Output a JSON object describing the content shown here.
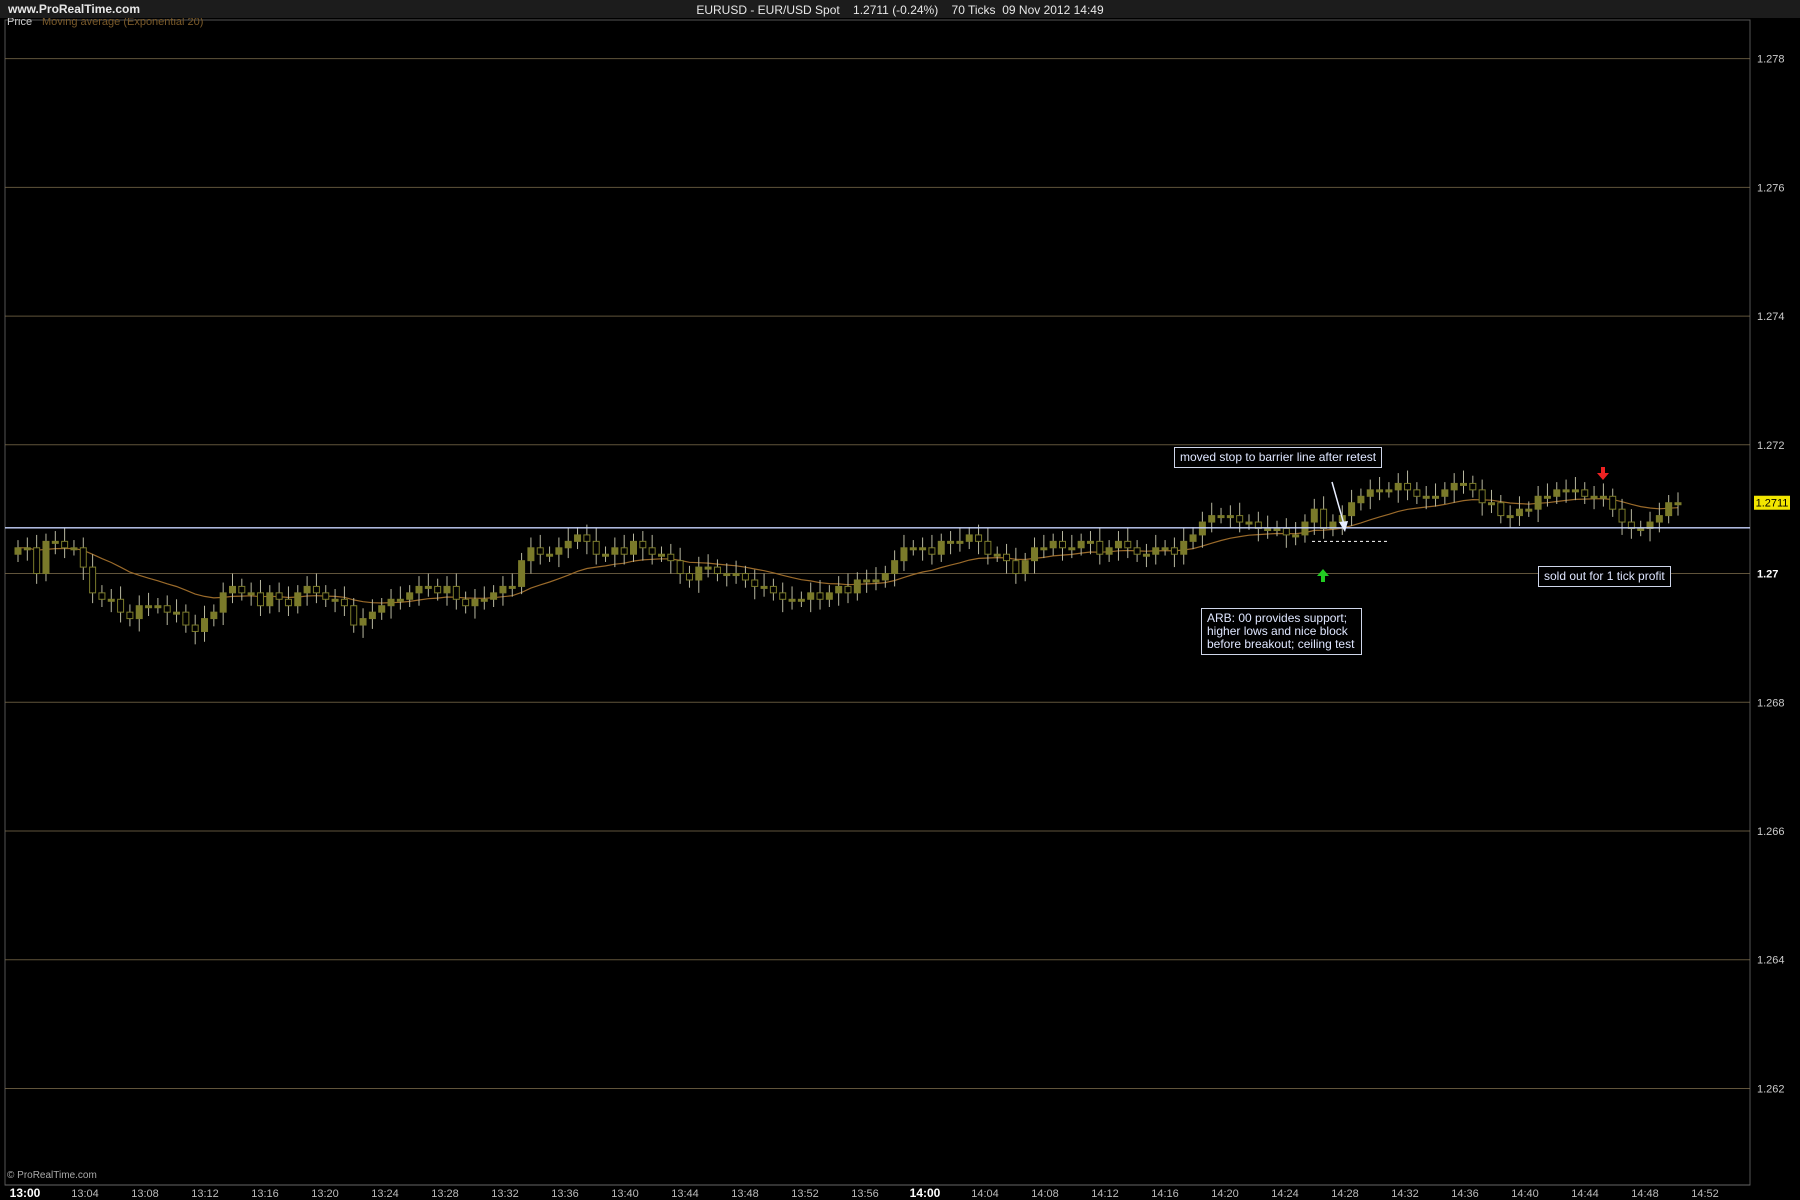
{
  "header": {
    "site": "www.ProRealTime.com",
    "info": "EURUSD - EUR/USD Spot    1.2711 (-0.24%)    70 Ticks  09 Nov 2012 14:49"
  },
  "legend": {
    "price": "Price",
    "indicator": "Moving average (Exponential 20)"
  },
  "footer": {
    "copyright": "© ProRealTime.com"
  },
  "colors": {
    "background": "#000000",
    "grid": "#7a6a4a",
    "candle": "#7a7a2a",
    "wick": "#b7b7a0",
    "ma": "#9a6a2a",
    "barrier": "#c8d4ff",
    "price_tag_bg": "#f2e600",
    "up_arrow": "#22cc22",
    "down_arrow": "#ee2222"
  },
  "chart_data": {
    "type": "candlestick",
    "y_range": [
      1.2605,
      1.2786
    ],
    "y_ticks": [
      "1.278",
      "1.276",
      "1.274",
      "1.272",
      "1.27",
      "1.268",
      "1.266",
      "1.264",
      "1.262"
    ],
    "x_ticks": [
      "13:00",
      "13:04",
      "13:08",
      "13:12",
      "13:16",
      "13:20",
      "13:24",
      "13:28",
      "13:32",
      "13:36",
      "13:40",
      "13:44",
      "13:48",
      "13:52",
      "13:56",
      "14:00",
      "14:04",
      "14:08",
      "14:12",
      "14:16",
      "14:20",
      "14:24",
      "14:28",
      "14:32",
      "14:36",
      "14:40",
      "14:44",
      "14:48",
      "14:52"
    ],
    "last_price": "1.2711",
    "barrier_level": 1.27071,
    "stop_level": 1.2705,
    "series_close": [
      1.2704,
      1.2704,
      1.27,
      1.2705,
      1.2705,
      1.2704,
      1.2704,
      1.2701,
      1.2697,
      1.2696,
      1.2696,
      1.2694,
      1.2693,
      1.2695,
      1.2695,
      1.2695,
      1.2694,
      1.2694,
      1.2692,
      1.2691,
      1.2693,
      1.2694,
      1.2697,
      1.2698,
      1.2697,
      1.2697,
      1.2695,
      1.2697,
      1.2696,
      1.2695,
      1.2697,
      1.2698,
      1.2697,
      1.2696,
      1.2696,
      1.2695,
      1.2692,
      1.2693,
      1.2694,
      1.2695,
      1.2696,
      1.2696,
      1.2697,
      1.2698,
      1.2698,
      1.2697,
      1.2698,
      1.2696,
      1.2695,
      1.2696,
      1.2696,
      1.2697,
      1.2698,
      1.2698,
      1.2702,
      1.2704,
      1.2703,
      1.2703,
      1.2704,
      1.2705,
      1.2706,
      1.2705,
      1.2703,
      1.2703,
      1.2704,
      1.2703,
      1.2705,
      1.2704,
      1.2703,
      1.2703,
      1.2702,
      1.27,
      1.2699,
      1.2701,
      1.2701,
      1.27,
      1.27,
      1.27,
      1.2699,
      1.2698,
      1.2698,
      1.2697,
      1.2696,
      1.2696,
      1.2696,
      1.2697,
      1.2696,
      1.2697,
      1.2698,
      1.2697,
      1.2699,
      1.2699,
      1.2699,
      1.27,
      1.2702,
      1.2704,
      1.2704,
      1.2704,
      1.2703,
      1.2705,
      1.2705,
      1.2705,
      1.2706,
      1.2705,
      1.2703,
      1.2703,
      1.2702,
      1.27,
      1.2702,
      1.2704,
      1.2704,
      1.2705,
      1.2704,
      1.2704,
      1.2705,
      1.2705,
      1.2703,
      1.2704,
      1.2705,
      1.2704,
      1.2703,
      1.2703,
      1.2704,
      1.2704,
      1.2703,
      1.2705,
      1.2706,
      1.2708,
      1.2709,
      1.2709,
      1.2709,
      1.2708,
      1.2708,
      1.2707,
      1.2707,
      1.2707,
      1.2706,
      1.2706,
      1.2708,
      1.271,
      1.2707,
      1.2708,
      1.2709,
      1.2711,
      1.2712,
      1.2713,
      1.2713,
      1.2713,
      1.2714,
      1.2713,
      1.2712,
      1.2712,
      1.2712,
      1.2713,
      1.2714,
      1.2714,
      1.2713,
      1.2711,
      1.2711,
      1.2709,
      1.2709,
      1.271,
      1.271,
      1.2712,
      1.2712,
      1.2713,
      1.2713,
      1.2713,
      1.2712,
      1.2712,
      1.2712,
      1.271,
      1.2708,
      1.2707,
      1.2707,
      1.2708,
      1.2709,
      1.2711,
      1.2711
    ],
    "annotations": [
      "moved stop to barrier line after retest",
      "ARB: 00 provides support; higher lows and nice block before breakout; ceiling test",
      "sold out for 1 tick profit"
    ]
  }
}
